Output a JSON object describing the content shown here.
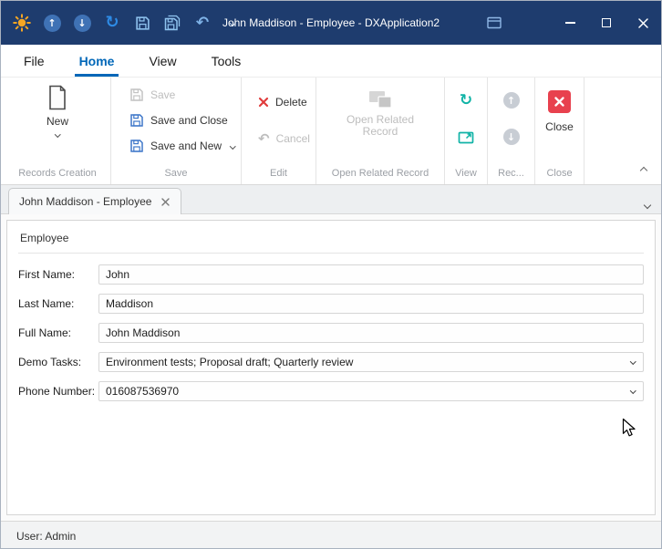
{
  "window": {
    "title": "John Maddison - Employee - DXApplication2"
  },
  "icons": {
    "refresh": "↻",
    "undo": "↶",
    "arrow_up": "↑",
    "arrow_down": "↓"
  },
  "menu": {
    "file": "File",
    "home": "Home",
    "view": "View",
    "tools": "Tools"
  },
  "ribbon": {
    "records_creation": {
      "label": "Records Creation",
      "new": "New"
    },
    "save": {
      "label": "Save",
      "save": "Save",
      "save_and_close": "Save and Close",
      "save_and_new": "Save and New"
    },
    "edit": {
      "label": "Edit",
      "delete": "Delete",
      "cancel": "Cancel"
    },
    "open_related": {
      "label": "Open Related Record",
      "button": "Open Related Record"
    },
    "view": {
      "label": "View"
    },
    "records_nav": {
      "label": "Rec..."
    },
    "close": {
      "label": "Close",
      "button": "Close"
    }
  },
  "tabs": {
    "active": "John Maddison - Employee"
  },
  "form": {
    "group": "Employee",
    "first_name": {
      "label": "First Name:",
      "value": "John"
    },
    "last_name": {
      "label": "Last Name:",
      "value": "Maddison"
    },
    "full_name": {
      "label": "Full Name:",
      "value": "John Maddison"
    },
    "demo_tasks": {
      "label": "Demo Tasks:",
      "value": "Environment tests; Proposal draft; Quarterly review"
    },
    "phone_number": {
      "label": "Phone Number:",
      "value": "016087536970"
    }
  },
  "statusbar": {
    "user": "User: Admin"
  },
  "colors": {
    "titlebar": "#1e3c6e",
    "accent_blue": "#0067b8",
    "delete_red": "#e03c3c",
    "close_red": "#e8414e",
    "view_teal": "#10b3a6"
  }
}
